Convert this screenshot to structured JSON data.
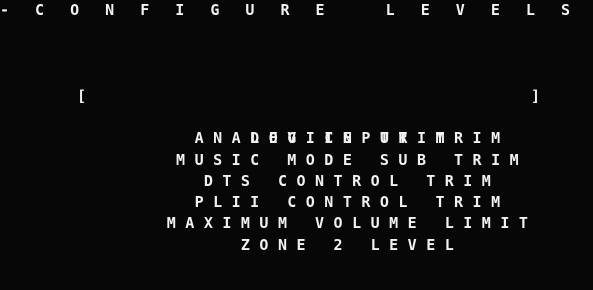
{
  "screen": {
    "title": "- C O N F I G U R E   L E V E L S -"
  },
  "menu": {
    "cursor_left": "[",
    "cursor_right": "]",
    "items": [
      {
        "label": "DEVICE TRIM",
        "selected": true
      },
      {
        "label": "ANALOG INPUT TRIM",
        "selected": false
      },
      {
        "label": "MUSIC MODE SUB TRIM",
        "selected": false
      },
      {
        "label": "DTS CONTROL TRIM",
        "selected": false
      },
      {
        "label": "PLII CONTROL TRIM",
        "selected": false
      },
      {
        "label": "MAXIMUM VOLUME LIMIT",
        "selected": false
      },
      {
        "label": "ZONE 2 LEVEL",
        "selected": false
      }
    ]
  },
  "colors": {
    "background": "#070707",
    "text": "#f2f2f2"
  }
}
